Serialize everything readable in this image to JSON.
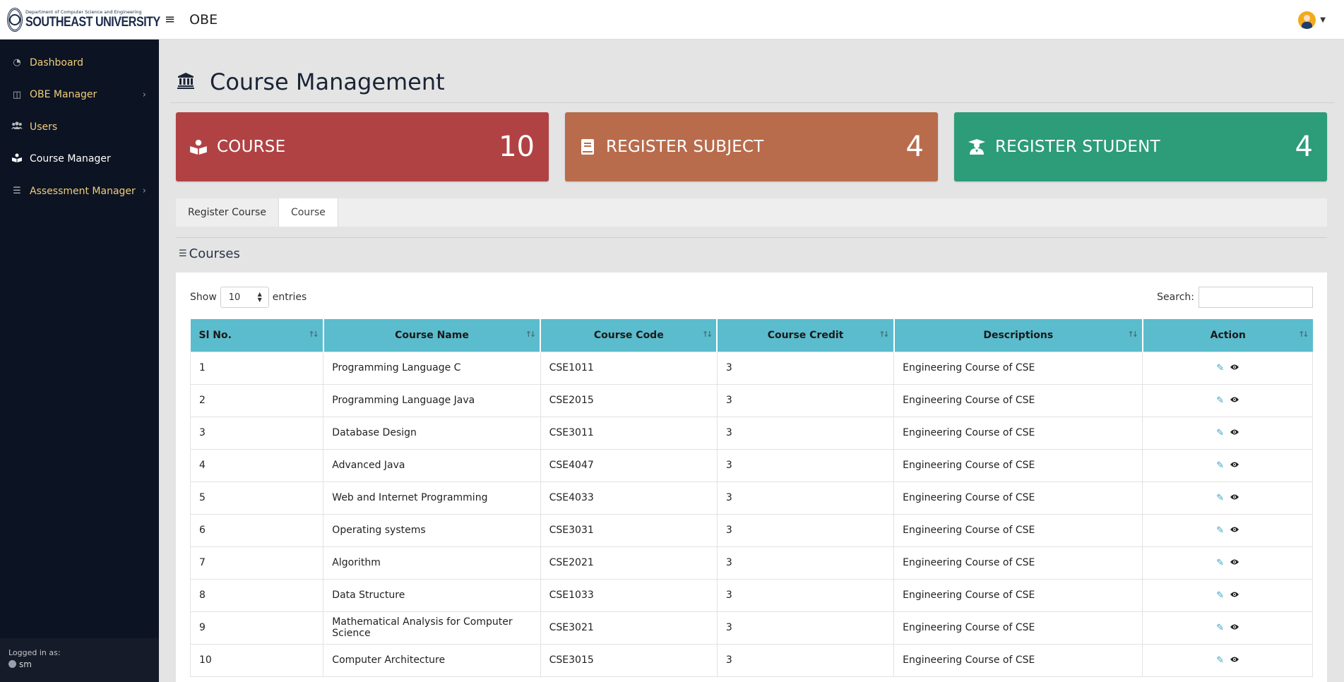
{
  "header": {
    "brand_dept": "Department of Computer Science and Engineering",
    "brand_name": "SOUTHEAST UNIVERSITY",
    "app_title": "OBE"
  },
  "sidebar": {
    "items": [
      {
        "label": "Dashboard",
        "icon": "tachometer-icon"
      },
      {
        "label": "OBE Manager",
        "icon": "table-icon"
      },
      {
        "label": "Users",
        "icon": "users-icon"
      },
      {
        "label": "Course Manager",
        "icon": "book-reader-icon"
      },
      {
        "label": "Assessment Manager",
        "icon": "list-icon"
      }
    ],
    "logged_in_label": "Logged in as:",
    "username": "sm"
  },
  "page": {
    "title": "Course Management"
  },
  "cards": [
    {
      "label": "COURSE",
      "value": "10",
      "color": "#b14244"
    },
    {
      "label": "REGISTER SUBJECT",
      "value": "4",
      "color": "#b86c4c"
    },
    {
      "label": "REGISTER STUDENT",
      "value": "4",
      "color": "#2d9c78"
    }
  ],
  "tabs": [
    {
      "label": "Register Course"
    },
    {
      "label": "Course"
    }
  ],
  "section": {
    "title": "Courses"
  },
  "table_controls": {
    "show_label": "Show",
    "entries_value": "10",
    "entries_label": "entries",
    "search_label": "Search:"
  },
  "table": {
    "headers": [
      "Sl No.",
      "Course Name",
      "Course Code",
      "Course Credit",
      "Descriptions",
      "Action"
    ],
    "rows": [
      [
        "1",
        "Programming Language C",
        "CSE1011",
        "3",
        "Engineering Course of CSE"
      ],
      [
        "2",
        "Programming Language Java",
        "CSE2015",
        "3",
        "Engineering Course of CSE"
      ],
      [
        "3",
        "Database Design",
        "CSE3011",
        "3",
        "Engineering Course of CSE"
      ],
      [
        "4",
        "Advanced Java",
        "CSE4047",
        "3",
        "Engineering Course of CSE"
      ],
      [
        "5",
        "Web and Internet Programming",
        "CSE4033",
        "3",
        "Engineering Course of CSE"
      ],
      [
        "6",
        "Operating systems",
        "CSE3031",
        "3",
        "Engineering Course of CSE"
      ],
      [
        "7",
        "Algorithm",
        "CSE2021",
        "3",
        "Engineering Course of CSE"
      ],
      [
        "8",
        "Data Structure",
        "CSE1033",
        "3",
        "Engineering Course of CSE"
      ],
      [
        "9",
        "Mathematical Analysis for Computer Science",
        "CSE3021",
        "3",
        "Engineering Course of CSE"
      ],
      [
        "10",
        "Computer Architecture",
        "CSE3015",
        "3",
        "Engineering Course of CSE"
      ]
    ]
  }
}
